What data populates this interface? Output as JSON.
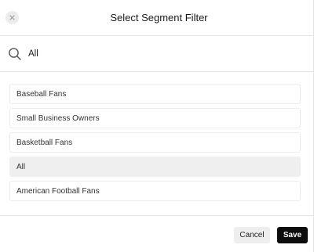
{
  "dialog": {
    "title": "Select Segment Filter"
  },
  "icons": {
    "close": "close-icon",
    "search": "search-icon"
  },
  "search": {
    "value": "All",
    "placeholder": ""
  },
  "segments": {
    "items": [
      {
        "label": "Baseball Fans",
        "selected": false
      },
      {
        "label": "Small Business Owners",
        "selected": false
      },
      {
        "label": "Basketball Fans",
        "selected": false
      },
      {
        "label": "All",
        "selected": true
      },
      {
        "label": "American Football Fans",
        "selected": false
      }
    ]
  },
  "footer": {
    "cancel_label": "Cancel",
    "save_label": "Save"
  },
  "colors": {
    "primary_button": "#0d0d0d",
    "secondary_button": "#eeeeee",
    "selected_row": "#efefef",
    "divider": "#e6e6e6"
  }
}
